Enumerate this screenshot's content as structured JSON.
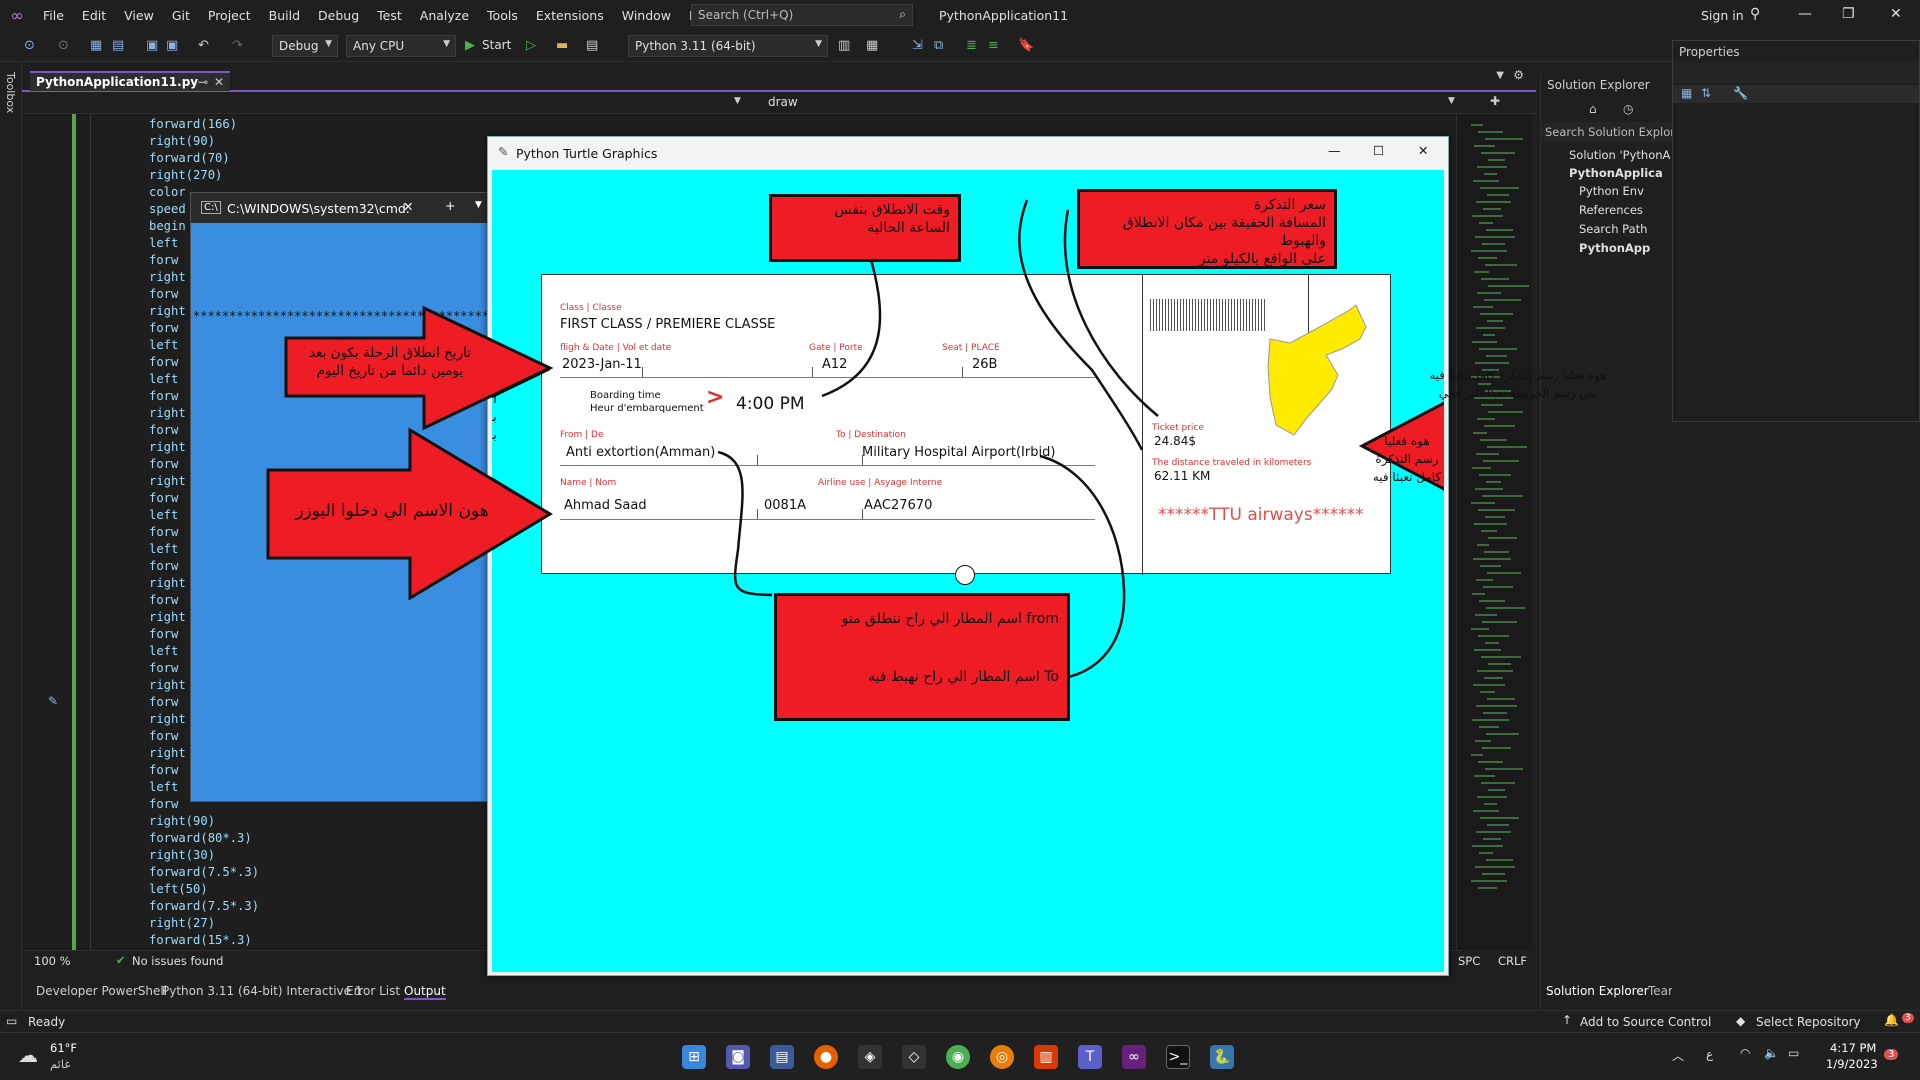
{
  "menubar": {
    "items": [
      "File",
      "Edit",
      "View",
      "Git",
      "Project",
      "Build",
      "Debug",
      "Test",
      "Analyze",
      "Tools",
      "Extensions",
      "Window",
      "Help"
    ],
    "search_placeholder": "Search (Ctrl+Q)",
    "app_title": "PythonApplication11",
    "sign_in": "Sign in"
  },
  "toolbar": {
    "config": "Debug",
    "platform": "Any CPU",
    "start": "Start",
    "environment": "Python 3.11 (64-bit)"
  },
  "toolbox_label": "Toolbox",
  "editor": {
    "tab_name": "PythonApplication11.py",
    "nav_member": "draw",
    "code_lines": [
      "forward(166)",
      "right(90)",
      "forward(70)",
      "right(270)",
      "color",
      "speed",
      "begin",
      "left",
      "forw",
      "right",
      "forw",
      "right",
      "forw",
      "left",
      "forw",
      "left",
      "forw",
      "right",
      "forw",
      "right",
      "forw",
      "right",
      "forw",
      "left",
      "forw",
      "left",
      "forw",
      "right",
      "forw",
      "right",
      "forw",
      "left",
      "forw",
      "right",
      "forw",
      "right",
      "forw",
      "right",
      "forw",
      "left",
      "forw",
      "right(90)",
      "forward(80*.3)",
      "right(30)",
      "forward(7.5*.3)",
      "left(50)",
      "forward(7.5*.3)",
      "right(27)",
      "forward(15*.3)"
    ],
    "zoom": "100 %",
    "issues": "No issues found",
    "encoding_spc": "SPC",
    "line_ending": "CRLF"
  },
  "bottom_tabs": [
    "Developer PowerShell",
    "Python 3.11 (64-bit) Interactive 1",
    "Error List",
    "Output"
  ],
  "solution_explorer": {
    "title": "Solution Explorer",
    "search_placeholder": "Search Solution Explore",
    "items": [
      "Solution 'PythonA",
      "PythonApplica",
      "Python Env",
      "References",
      "Search Path",
      "PythonApp"
    ],
    "tabs": [
      "Solution Explorer",
      "Team Explorer"
    ]
  },
  "properties": {
    "title": "Properties"
  },
  "statusbar": {
    "ready": "Ready",
    "add_source": "Add to Source Control",
    "select_repo": "Select Repository",
    "notif_count": "3"
  },
  "taskbar": {
    "temp": "61°F",
    "weather": "غائم",
    "time": "4:17 PM",
    "date": "1/9/2023",
    "lang": "ع",
    "notif": "3"
  },
  "cmd": {
    "title": "C:\\WINDOWS\\system32\\cmd.",
    "stars": "**********************************************************"
  },
  "turtle": {
    "title": "Python Turtle Graphics",
    "ticket": {
      "class_label": "Class | Classe",
      "class_value": "FIRST CLASS / PREMIERE CLASSE",
      "date_label": "fligh & Date | Vol et date",
      "date_value": "2023-Jan-11",
      "gate_label": "Gate | Porte",
      "gate_value": "A12",
      "seat_label": "Seat | PLACE",
      "seat_value": "26B",
      "boarding_label_1": "Boarding time",
      "boarding_label_2": "Heur d'embarquement",
      "boarding_arrow": ">",
      "boarding_time": "4:00 PM",
      "from_label": "From | De",
      "from_value": "Anti extortion(Amman)",
      "to_label": "To | Destination",
      "to_value": "Military Hospital Airport(Irbid)",
      "name_label": "Name | Nom",
      "name_value": "Ahmad Saad",
      "flight_no": "0081A",
      "airline_label": "Airline use | Asyage Interne",
      "airline_value": "AAC27670",
      "price_label": "Ticket price",
      "price_value": "24.84$",
      "distance_label": "The distance traveled in kilometers",
      "distance_value": "62.11 KM",
      "brand": "******TTU airways******"
    },
    "annotations": {
      "time_note_1": "وقت الانطلاق بنفس",
      "time_note_2": "الساعة الحالية",
      "price_note_1": "سعر التذكرة",
      "price_note_2": "المسافة الحقيقة بين مكان الانطلاق والهبوط",
      "price_note_3": "على الواقع بالكيلو متر",
      "date_note_1": "تاريخ انطلاق الرحلة بكون بعد",
      "date_note_2": "يومين دائما من تاريخ اليوم",
      "name_note": "هون الاسم الي دخلوا اليوزر",
      "map_note_1": "هوه فعليا رسم التذكرة كامل تعبئا فيه",
      "map_note_2": "بس رسم الخريطة تعبئا اكثر اشي",
      "airport_note_1": "from اسم المطار الي راح ننطلق منو",
      "airport_note_2": "To اسم المطار الي راح نهبط فيه"
    }
  },
  "colors": {
    "accent": "#7e57c2",
    "canvas": "#00ffff",
    "annotation_red": "#ee1c24",
    "map_yellow": "#ffeb00",
    "ticket_red": "#e03030"
  }
}
